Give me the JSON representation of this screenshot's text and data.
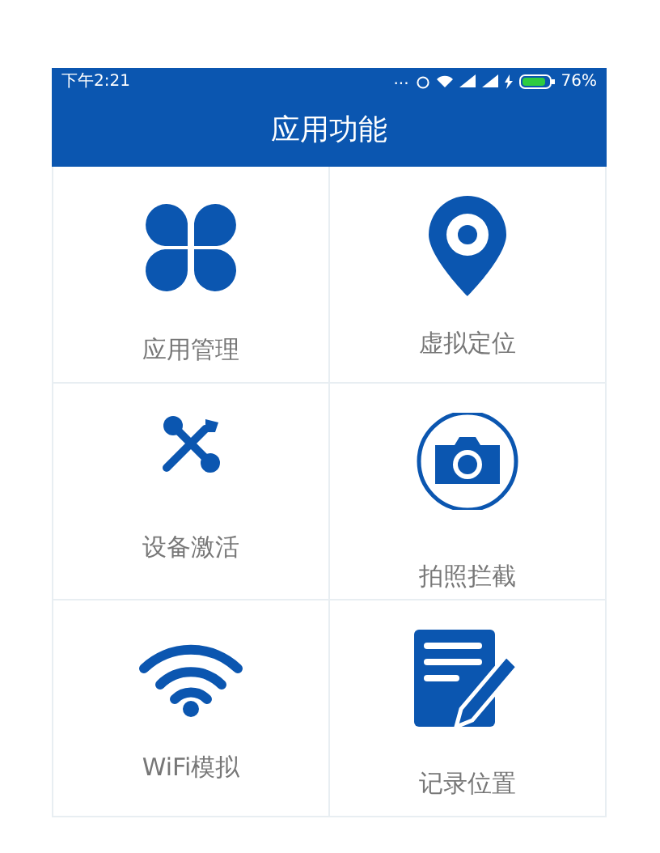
{
  "status_bar": {
    "time": "下午2:21",
    "dots": "...",
    "battery_text": "76%"
  },
  "header": {
    "title": "应用功能"
  },
  "items": [
    {
      "kind": "clover",
      "label": "应用管理"
    },
    {
      "kind": "pin",
      "label": "虚拟定位"
    },
    {
      "kind": "tools",
      "label": "设备激活"
    },
    {
      "kind": "camera",
      "label": "拍照拦截"
    },
    {
      "kind": "wifi",
      "label": "WiFi模拟"
    },
    {
      "kind": "note",
      "label": "记录位置"
    }
  ]
}
